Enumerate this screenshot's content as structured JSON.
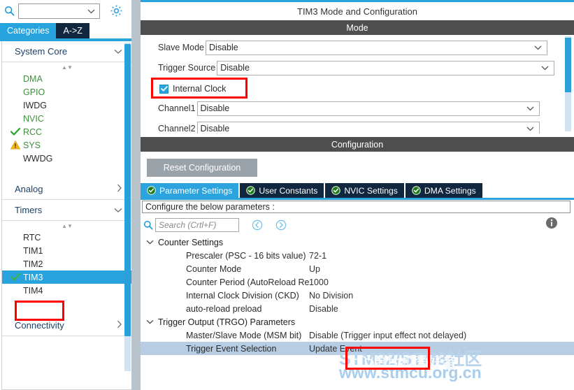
{
  "sidebar": {
    "search": {
      "value": "",
      "placeholder": "",
      "icon": "search-icon",
      "dropdown_icon": "chevron-down-icon"
    },
    "settings_icon": "gear-icon",
    "tabs": [
      {
        "label": "Categories",
        "active": true
      },
      {
        "label": "A->Z",
        "active": false
      }
    ],
    "groups": [
      {
        "label": "System Core",
        "expanded": true,
        "chevron": "chevron-down-icon",
        "items": [
          {
            "label": "DMA",
            "status": "none",
            "state": "configurable",
            "selected": false
          },
          {
            "label": "GPIO",
            "status": "none",
            "state": "configurable",
            "selected": false
          },
          {
            "label": "IWDG",
            "status": "none",
            "state": "plain",
            "selected": false
          },
          {
            "label": "NVIC",
            "status": "none",
            "state": "configurable",
            "selected": false
          },
          {
            "label": "RCC",
            "status": "check",
            "state": "configurable",
            "selected": false
          },
          {
            "label": "SYS",
            "status": "warning",
            "state": "configurable",
            "selected": false
          },
          {
            "label": "WWDG",
            "status": "none",
            "state": "plain",
            "selected": false
          }
        ]
      },
      {
        "label": "Analog",
        "expanded": false,
        "chevron": "chevron-right-icon",
        "items": []
      },
      {
        "label": "Timers",
        "expanded": true,
        "chevron": "chevron-down-icon",
        "items": [
          {
            "label": "RTC",
            "status": "none",
            "state": "plain",
            "selected": false
          },
          {
            "label": "TIM1",
            "status": "none",
            "state": "plain",
            "selected": false
          },
          {
            "label": "TIM2",
            "status": "none",
            "state": "plain",
            "selected": false
          },
          {
            "label": "TIM3",
            "status": "check",
            "state": "plain",
            "selected": true
          },
          {
            "label": "TIM4",
            "status": "none",
            "state": "plain",
            "selected": false
          }
        ]
      },
      {
        "label": "Connectivity",
        "expanded": false,
        "chevron": "chevron-right-icon",
        "items": []
      }
    ]
  },
  "panel": {
    "title": "TIM3 Mode and Configuration",
    "mode_bar": "Mode",
    "config_bar": "Configuration",
    "mode": {
      "rows": [
        {
          "label": "Slave Mode",
          "value": "Disable",
          "chevron": "chevron-down-icon"
        },
        {
          "label": "Trigger Source",
          "value": "Disable",
          "chevron": "chevron-down-icon"
        }
      ],
      "checkbox": {
        "label": "Internal Clock",
        "checked": true
      },
      "channels": [
        {
          "label": "Channel1",
          "value": "Disable",
          "chevron": "chevron-down-icon"
        },
        {
          "label": "Channel2",
          "value": "Disable",
          "chevron": "chevron-down-icon"
        }
      ]
    },
    "config": {
      "reset_button": "Reset Configuration",
      "tabs": [
        {
          "label": "Parameter Settings",
          "active": true,
          "icon": "check-circle-icon"
        },
        {
          "label": "User Constants",
          "active": false,
          "icon": "check-circle-icon"
        },
        {
          "label": "NVIC Settings",
          "active": false,
          "icon": "check-circle-icon"
        },
        {
          "label": "DMA Settings",
          "active": false,
          "icon": "check-circle-icon"
        }
      ],
      "note": "Configure the below parameters :",
      "search": {
        "value": "",
        "placeholder": "Search (Crtl+F)",
        "icon": "search-icon"
      },
      "nav_back_icon": "circle-left-arrow-icon",
      "nav_forward_icon": "circle-right-arrow-icon",
      "info_icon": "info-icon",
      "sections": [
        {
          "label": "Counter Settings",
          "chevron": "chevron-down-icon",
          "rows": [
            {
              "name": "Prescaler (PSC - 16 bits value)",
              "value": "72-1",
              "selected": false
            },
            {
              "name": "Counter Mode",
              "value": "Up",
              "selected": false
            },
            {
              "name": "Counter Period (AutoReload Register - ...",
              "value": "1000",
              "selected": false
            },
            {
              "name": "Internal Clock Division (CKD)",
              "value": "No Division",
              "selected": false
            },
            {
              "name": "auto-reload preload",
              "value": "Disable",
              "selected": false
            }
          ]
        },
        {
          "label": "Trigger Output (TRGO) Parameters",
          "chevron": "chevron-down-icon",
          "rows": [
            {
              "name": "Master/Slave Mode (MSM bit)",
              "value": "Disable (Trigger input effect not delayed)",
              "selected": false
            },
            {
              "name": "Trigger Event Selection",
              "value": "Update Event",
              "selected": true
            }
          ]
        }
      ]
    }
  },
  "annotations": [
    {
      "name": "internal-clock-highlight",
      "target": "Internal Clock"
    },
    {
      "name": "tim3-highlight",
      "target": "TIM3"
    },
    {
      "name": "update-event-highlight",
      "target": "Update Event"
    }
  ],
  "watermark": {
    "line1": "STM32/STM8社区",
    "line2": "www.stmcu.org.cn",
    "overlay": "单片机爱好者"
  },
  "colors": {
    "accent_blue": "#2aa3dd",
    "dark_navy": "#11263f",
    "bar_gray": "#4f4f4f",
    "selected_row": "#b7cde4",
    "annotation_red": "#ff0000",
    "status_green": "#3d8f3d",
    "status_warning": "#f2b61c"
  }
}
